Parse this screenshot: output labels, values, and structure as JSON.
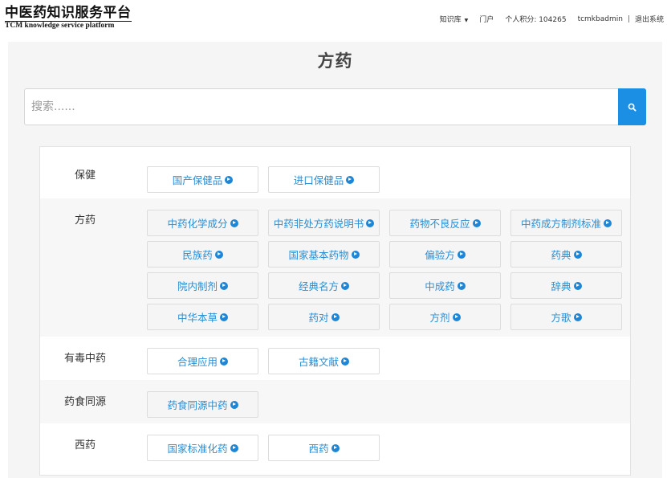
{
  "header": {
    "logo_title": "中医药知识服务平台",
    "logo_subtitle": "TCM knowledge service platform",
    "nav": {
      "knowledge_base": "知识库",
      "portal": "门户",
      "points": "个人积分: 104265",
      "username": "tcmkbadmin",
      "separator": "|",
      "logout": "退出系统"
    }
  },
  "page": {
    "title": "方药"
  },
  "search": {
    "placeholder": "搜索......",
    "value": ""
  },
  "icons": {
    "search": "search-icon",
    "item_arrow": "circle-arrow-right-icon",
    "dropdown": "caret-down-icon"
  },
  "colors": {
    "accent": "#1a8fe3",
    "link": "#2a8ed4"
  },
  "categories": [
    {
      "label": "保健",
      "items": [
        "国产保健品",
        "进口保健品"
      ]
    },
    {
      "label": "方药",
      "items": [
        "中药化学成分",
        "中药非处方药说明书",
        "药物不良反应",
        "中药成方制剂标准",
        "民族药",
        "国家基本药物",
        "偏验方",
        "药典",
        "院内制剂",
        "经典名方",
        "中成药",
        "辞典",
        "中华本草",
        "药对",
        "方剂",
        "方歌"
      ]
    },
    {
      "label": "有毒中药",
      "items": [
        "合理应用",
        "古籍文献"
      ]
    },
    {
      "label": "药食同源",
      "items": [
        "药食同源中药"
      ]
    },
    {
      "label": "西药",
      "items": [
        "国家标准化药",
        "西药"
      ]
    }
  ]
}
